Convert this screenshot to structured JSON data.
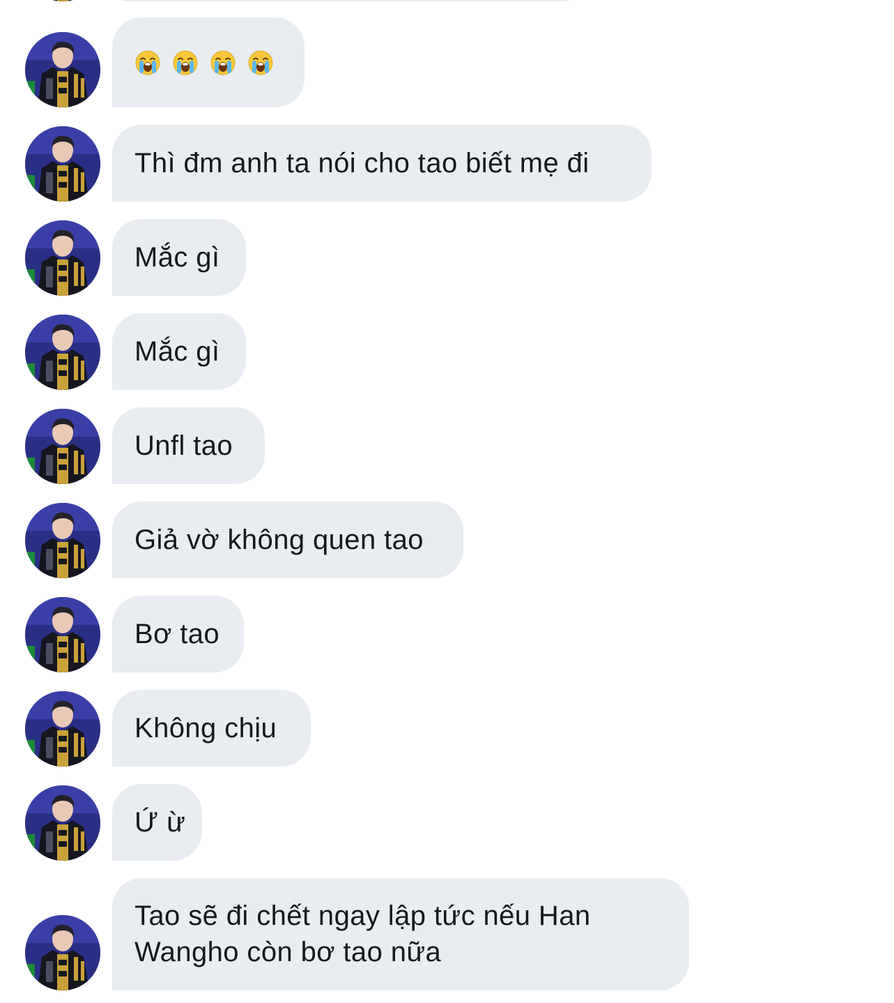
{
  "conversation": {
    "messages": [
      {
        "id": "m1",
        "type": "emoji",
        "emoji_icons": [
          "loudly-crying-face-icon",
          "loudly-crying-face-icon",
          "loudly-crying-face-icon",
          "loudly-crying-face-icon"
        ]
      },
      {
        "id": "m2",
        "type": "text",
        "text": "Thì đm anh ta nói cho tao biết mẹ đi"
      },
      {
        "id": "m3",
        "type": "text",
        "text": "Mắc gì"
      },
      {
        "id": "m4",
        "type": "text",
        "text": "Mắc gì"
      },
      {
        "id": "m5",
        "type": "text",
        "text": "Unfl tao"
      },
      {
        "id": "m6",
        "type": "text",
        "text": "Giả vờ không quen tao"
      },
      {
        "id": "m7",
        "type": "text",
        "text": "Bơ tao"
      },
      {
        "id": "m8",
        "type": "text",
        "text": "Không chịu"
      },
      {
        "id": "m9",
        "type": "text",
        "text": "Ứ ừ"
      },
      {
        "id": "m10",
        "type": "text",
        "text": "Tao sẽ đi chết ngay lập tức nếu Han Wangho còn bơ tao nữa"
      }
    ]
  },
  "theme": {
    "bubble_color": "#e9edf1",
    "text_color": "#16181b",
    "background": "#ffffff"
  }
}
